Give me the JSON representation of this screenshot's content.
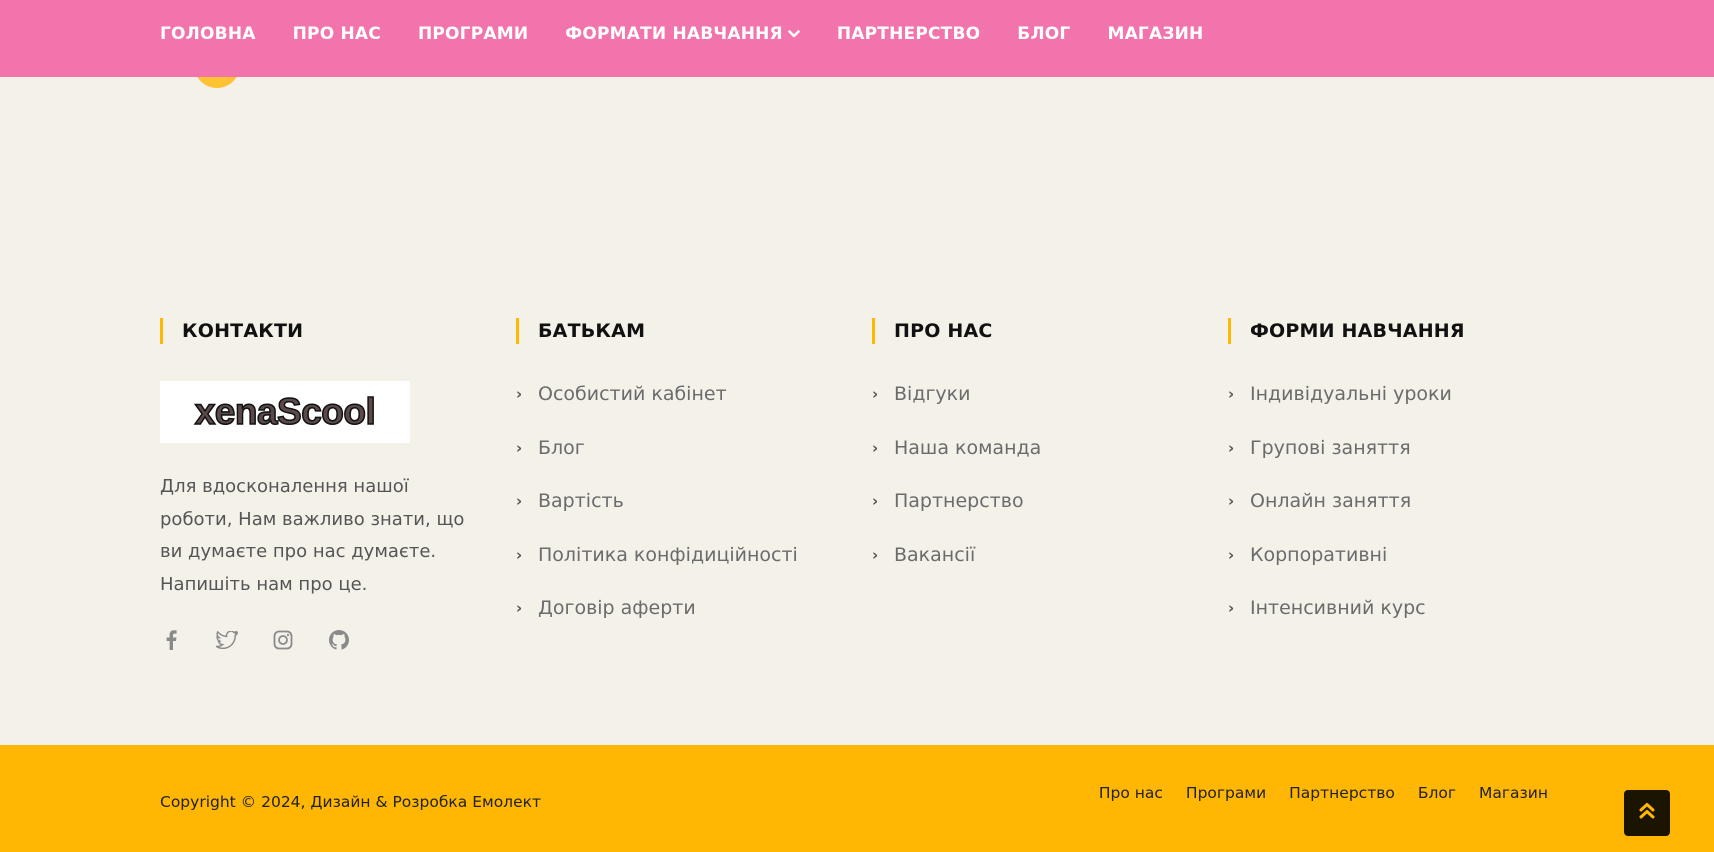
{
  "nav": {
    "items": [
      {
        "label": "ГОЛОВНА"
      },
      {
        "label": "ПРО НАС"
      },
      {
        "label": "ПРОГРАМИ"
      },
      {
        "label": "ФОРМАТИ НАВЧАННЯ",
        "has_dropdown": true
      },
      {
        "label": "ПАРТНЕРСТВО"
      },
      {
        "label": "БЛОГ"
      },
      {
        "label": "МАГАЗИН"
      }
    ]
  },
  "footer": {
    "contacts": {
      "heading": "КОНТАКТИ",
      "logo_text": "xenaScool",
      "description": "Для вдосконалення нашої роботи, Нам важливо знати, що ви думаєте про нас думаєте. Напишіть нам про це.",
      "socials": [
        "facebook-icon",
        "twitter-icon",
        "instagram-icon",
        "github-icon"
      ]
    },
    "parents": {
      "heading": "БАТЬКАМ",
      "links": [
        "Особистий кабінет",
        "Блог",
        "Вартість",
        "Політика конфідиційності",
        "Договір аферти"
      ]
    },
    "about": {
      "heading": "ПРО НАС",
      "links": [
        "Відгуки",
        "Наша команда",
        "Партнерство",
        "Вакансії"
      ]
    },
    "forms": {
      "heading": "ФОРМИ НАВЧАННЯ",
      "links": [
        "Індивідуальні уроки",
        "Групові заняття",
        "Онлайн заняття",
        "Корпоративні",
        "Інтенсивний курс"
      ]
    }
  },
  "bottom": {
    "copyright": "Copyright © 2024, Дизайн & Розробка Емолект",
    "links": [
      "Про нас",
      "Програми",
      "Партнерство",
      "Блог",
      "Магазин"
    ]
  },
  "colors": {
    "nav_bg": "#f174ac",
    "page_bg": "#f4f1e9",
    "accent": "#ffb703",
    "to_top_bg": "#1a1400"
  }
}
